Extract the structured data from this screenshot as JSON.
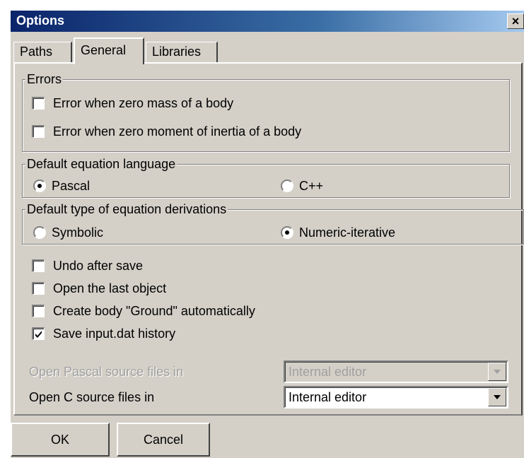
{
  "window": {
    "title": "Options",
    "close_glyph": "×"
  },
  "tabs": [
    {
      "label": "Paths",
      "active": false
    },
    {
      "label": "General",
      "active": true
    },
    {
      "label": "Libraries",
      "active": false
    }
  ],
  "errors": {
    "legend": "Errors",
    "items": [
      {
        "label": "Error when zero mass of a body",
        "checked": false
      },
      {
        "label": "Error when zero moment of inertia of a body",
        "checked": false
      }
    ]
  },
  "language": {
    "legend": "Default equation language",
    "options": [
      {
        "label": "Pascal",
        "selected": true
      },
      {
        "label": "C++",
        "selected": false
      }
    ]
  },
  "derivation": {
    "legend": "Default type of equation derivations",
    "options": [
      {
        "label": "Symbolic",
        "selected": false
      },
      {
        "label": "Numeric-iterative",
        "selected": true
      }
    ]
  },
  "options": [
    {
      "label": "Undo after save",
      "checked": false
    },
    {
      "label": "Open the last object",
      "checked": false
    },
    {
      "label": "Create body \"Ground\" automatically",
      "checked": false
    },
    {
      "label": "Save input.dat history",
      "checked": true
    }
  ],
  "editors": {
    "pascal": {
      "label": "Open Pascal source files in",
      "value": "Internal editor",
      "enabled": false
    },
    "c": {
      "label": "Open C source files in",
      "value": "Internal editor",
      "enabled": true
    }
  },
  "buttons": {
    "ok": "OK",
    "cancel": "Cancel"
  }
}
